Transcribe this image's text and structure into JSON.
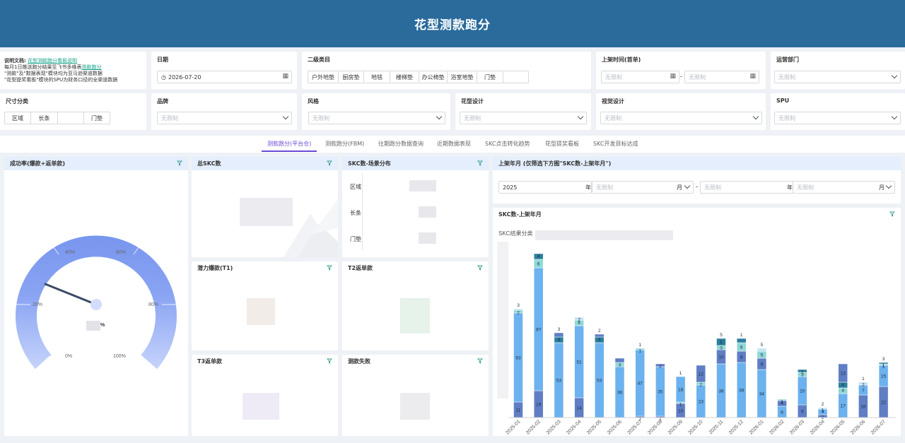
{
  "header": {
    "title": "花型测款跑分"
  },
  "note": {
    "line1_bold": "说明文档:",
    "line1_link": "花型测款跑分看板说明",
    "line2_text": "每月1日推送跑分结果至飞书多维表",
    "line2_link": "测款跑分",
    "line3": "\"测款\"及\"数据表现\"模块均为亚马逊渠道数据",
    "line4": "\"花型提奖看板\"模块的SPU为财务口径的全渠道数据"
  },
  "filters": {
    "date": {
      "label": "日期",
      "value": "2026-07-20",
      "icon": "clock-icon"
    },
    "category": {
      "label": "二级类目",
      "chips": [
        "户外地垫",
        "厨房垫",
        "地毯",
        "楼梯垫",
        "办公椅垫",
        "浴室地垫",
        "门垫"
      ]
    },
    "launch_time": {
      "label": "上架时间(首单)",
      "start_placeholder": "无限制",
      "end_placeholder": "无限制",
      "separator": "-"
    },
    "department": {
      "label": "运营部门",
      "placeholder": "无限制"
    },
    "size": {
      "label": "尺寸分类",
      "chips": [
        "区域",
        "长条",
        "",
        "门垫"
      ]
    },
    "brand": {
      "label": "品牌",
      "placeholder": "无限制"
    },
    "style": {
      "label": "风格",
      "placeholder": "无限制"
    },
    "pattern_design": {
      "label": "花型设计",
      "placeholder": "无限制"
    },
    "visual_design": {
      "label": "视觉设计",
      "placeholder": "无限制"
    },
    "spu": {
      "label": "SPU",
      "placeholder": "无限制"
    }
  },
  "tabs": [
    "测款跑分(平台仓)",
    "测款跑分(FBM)",
    "往期跑分数据查询",
    "近期数据表现",
    "SKC点击转化趋势",
    "花型提奖看板",
    "SKC开发目标达成"
  ],
  "active_tab": 0,
  "panels": {
    "success_rate": {
      "title": "成功率(爆款+返单款)",
      "value_suffix": "%",
      "ticks": [
        "0%",
        "20%",
        "40%",
        "60%",
        "80%",
        "100%"
      ]
    },
    "total_skc": {
      "title": "总SKC数"
    },
    "skc_scene": {
      "title": "SKC数-场景分布",
      "rows": [
        "区域",
        "长条",
        "门垫"
      ]
    },
    "potential": {
      "title": "潜力爆款(T1)"
    },
    "t2": {
      "title": "T2返单款"
    },
    "t3": {
      "title": "T3返单款"
    },
    "fail": {
      "title": "测款失败"
    },
    "launch_month": {
      "title": "上架年月 (仅筛选下方图\"SKC数-上架年月\")",
      "start_year": "2025",
      "year_label": "年",
      "start_month_placeholder": "无限制",
      "month_label": "月",
      "separator": "-",
      "end_year_placeholder": "无限制",
      "end_month_placeholder": "无限制"
    },
    "skc_month": {
      "title": "SKC数-上架年月",
      "legend_label": "SKC结果分类"
    }
  },
  "colors": {
    "header": "#2a6b9c",
    "accent": "#6a4bd6",
    "seg_main": "#6cb2ee",
    "seg_dark": "#5f7ec4",
    "seg_teal": "#2b7f9c",
    "seg_mint": "#8fd8d6",
    "seg_pale": "#bfe3f3"
  },
  "chart_data": {
    "type": "bar",
    "stacked": true,
    "categories": [
      "2025-01",
      "2025-02",
      "2025-03",
      "2025-04",
      "2025-05",
      "2025-06",
      "2025-07",
      "2025-08",
      "2025-09",
      "2025-10",
      "2025-11",
      "2025-12",
      "2026-01",
      "2026-02",
      "2026-03",
      "2026-04",
      "2026-05",
      "2026-06",
      "2026-07"
    ],
    "stacks": [
      [
        [
          11,
          "dark",
          "11"
        ],
        [
          63,
          "main",
          "63"
        ],
        [
          2,
          "mint",
          "2"
        ],
        [
          1,
          "pale",
          ""
        ],
        [
          0,
          "",
          "3"
        ]
      ],
      [
        [
          19,
          "dark",
          "19"
        ],
        [
          87,
          "main",
          "87"
        ],
        [
          6,
          "mint",
          "6"
        ],
        [
          4,
          "teal",
          "4"
        ]
      ],
      [
        [
          53,
          "main",
          "53"
        ],
        [
          4,
          "teal",
          "4"
        ],
        [
          3,
          "dark",
          ""
        ],
        [
          0,
          "",
          "3"
        ]
      ],
      [
        [
          14,
          "dark",
          "14"
        ],
        [
          51,
          "main",
          "51"
        ],
        [
          4,
          "mint",
          "4"
        ],
        [
          2,
          "pale",
          "2"
        ]
      ],
      [
        [
          53,
          "main",
          "53"
        ],
        [
          4,
          "teal",
          "4"
        ],
        [
          2,
          "dark",
          ""
        ],
        [
          0,
          "",
          "2"
        ]
      ],
      [
        [
          36,
          "main",
          "36"
        ],
        [
          3,
          "mint",
          "3"
        ],
        [
          3,
          "dark",
          ""
        ]
      ],
      [
        [
          1,
          "dark",
          "1"
        ],
        [
          47,
          "main",
          "47"
        ],
        [
          1,
          "mint",
          "1"
        ],
        [
          0,
          "",
          "1"
        ]
      ],
      [
        [
          1,
          "dark",
          "1"
        ],
        [
          35,
          "main",
          "35"
        ],
        [
          2,
          "dark",
          "2"
        ]
      ],
      [
        [
          10,
          "dark",
          "10"
        ],
        [
          1,
          "mint",
          "1"
        ],
        [
          18,
          "main",
          "18"
        ],
        [
          0,
          "",
          "1"
        ]
      ],
      [
        [
          23,
          "main",
          "23"
        ],
        [
          2,
          "mint",
          "2"
        ],
        [
          12,
          "dark",
          "12"
        ]
      ],
      [
        [
          38,
          "main",
          "38"
        ],
        [
          10,
          "dark",
          "10"
        ],
        [
          3,
          "mint",
          "3"
        ],
        [
          5,
          "teal",
          "5"
        ],
        [
          0,
          "",
          "5"
        ]
      ],
      [
        [
          39,
          "main",
          "39"
        ],
        [
          8,
          "dark",
          "8"
        ],
        [
          6,
          "mint",
          "6"
        ],
        [
          3,
          "teal",
          ""
        ],
        [
          0,
          "",
          "1"
        ]
      ],
      [
        [
          34,
          "main",
          "34"
        ],
        [
          8,
          "dark",
          "8"
        ],
        [
          5,
          "mint",
          "5"
        ],
        [
          2,
          "pale",
          ""
        ],
        [
          0,
          "",
          "5"
        ]
      ],
      [
        [
          8,
          "main",
          "8"
        ],
        [
          4,
          "dark",
          "4"
        ],
        [
          1,
          "mint",
          "1"
        ]
      ],
      [
        [
          9,
          "dark",
          "9"
        ],
        [
          20,
          "main",
          "20"
        ],
        [
          3,
          "mint",
          "3"
        ],
        [
          2,
          "teal",
          "2"
        ]
      ],
      [
        [
          2,
          "dark",
          "2"
        ],
        [
          4,
          "main",
          "4"
        ],
        [
          1,
          "pale",
          "1"
        ],
        [
          0,
          "",
          "2"
        ]
      ],
      [
        [
          17,
          "main",
          "17"
        ],
        [
          4,
          "mint",
          "4"
        ],
        [
          4,
          "teal",
          "4"
        ],
        [
          13,
          "dark",
          "13"
        ]
      ],
      [
        [
          16,
          "dark",
          "16"
        ],
        [
          7,
          "main",
          "7"
        ],
        [
          2,
          "pale",
          "2"
        ],
        [
          0,
          "",
          "1"
        ]
      ],
      [
        [
          22,
          "dark",
          "22"
        ],
        [
          15,
          "main",
          "15"
        ],
        [
          1,
          "mint",
          "1"
        ],
        [
          1,
          "teal",
          "1"
        ],
        [
          0,
          "",
          "3"
        ]
      ]
    ]
  }
}
